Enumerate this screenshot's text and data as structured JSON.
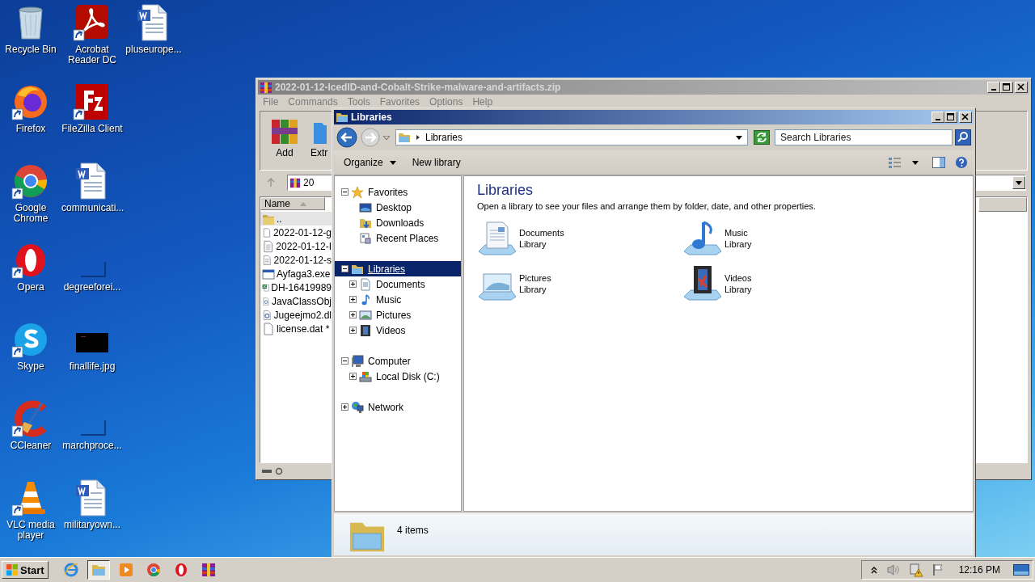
{
  "desktop_icons": [
    {
      "label": "Recycle Bin",
      "kind": "recycle",
      "shortcut": false
    },
    {
      "label": "Firefox",
      "kind": "firefox",
      "shortcut": true
    },
    {
      "label": "Google Chrome",
      "kind": "chrome",
      "shortcut": true
    },
    {
      "label": "Opera",
      "kind": "opera",
      "shortcut": true
    },
    {
      "label": "Skype",
      "kind": "skype",
      "shortcut": true
    },
    {
      "label": "CCleaner",
      "kind": "ccleaner",
      "shortcut": true
    },
    {
      "label": "VLC media player",
      "kind": "vlc",
      "shortcut": true
    },
    {
      "label": "Acrobat Reader DC",
      "kind": "acrobat",
      "shortcut": true
    },
    {
      "label": "FileZilla Client",
      "kind": "filezilla",
      "shortcut": true
    },
    {
      "label": "communicati...",
      "kind": "word",
      "shortcut": false
    },
    {
      "label": "degreeforei...",
      "kind": "blank",
      "shortcut": false
    },
    {
      "label": "finallife.jpg",
      "kind": "image",
      "shortcut": false
    },
    {
      "label": "marchproce...",
      "kind": "blank",
      "shortcut": false
    },
    {
      "label": "militaryown...",
      "kind": "word",
      "shortcut": false
    },
    {
      "label": "pluseurope...",
      "kind": "word",
      "shortcut": false
    }
  ],
  "winrar": {
    "title": "2022-01-12-IcedID-and-Cobalt-Strike-malware-and-artifacts.zip",
    "menu": [
      "File",
      "Commands",
      "Tools",
      "Favorites",
      "Options",
      "Help"
    ],
    "toolbar": [
      {
        "label": "Add",
        "kind": "add"
      },
      {
        "label": "Extr",
        "kind": "extract"
      }
    ],
    "path": "20",
    "column": "Name",
    "files": [
      {
        "name": "..",
        "kind": "folder",
        "selected": true
      },
      {
        "name": "2022-01-12-g",
        "kind": "file",
        "selected": false
      },
      {
        "name": "2022-01-12-I",
        "kind": "text",
        "selected": false
      },
      {
        "name": "2022-01-12-s",
        "kind": "text",
        "selected": false
      },
      {
        "name": "Ayfaga3.exe",
        "kind": "exe",
        "selected": false
      },
      {
        "name": "DH-16419989",
        "kind": "sheet",
        "selected": false
      },
      {
        "name": "JavaClassObj",
        "kind": "dll",
        "selected": false
      },
      {
        "name": "Jugeejmo2.dl",
        "kind": "dll",
        "selected": false
      },
      {
        "name": "license.dat *",
        "kind": "file",
        "selected": false
      }
    ]
  },
  "explorer": {
    "title": "Libraries",
    "address": "Libraries",
    "search": {
      "placeholder": "Search Libraries"
    },
    "toolbar": [
      "Organize",
      "New library"
    ],
    "nav": [
      {
        "label": "Favorites",
        "kind": "star",
        "expanded": true,
        "selected": false,
        "children": [
          {
            "label": "Desktop",
            "kind": "desktop",
            "selected": false
          },
          {
            "label": "Downloads",
            "kind": "downloads",
            "selected": false
          },
          {
            "label": "Recent Places",
            "kind": "recent",
            "selected": false
          }
        ]
      },
      {
        "label": "Libraries",
        "kind": "library",
        "expanded": true,
        "selected": true,
        "children": [
          {
            "label": "Documents",
            "kind": "documents",
            "expanded": false,
            "selected": false
          },
          {
            "label": "Music",
            "kind": "music",
            "expanded": false,
            "selected": false
          },
          {
            "label": "Pictures",
            "kind": "pictures",
            "expanded": false,
            "selected": false
          },
          {
            "label": "Videos",
            "kind": "videos",
            "expanded": false,
            "selected": false
          }
        ]
      },
      {
        "label": "Computer",
        "kind": "computer",
        "expanded": true,
        "selected": false,
        "children": [
          {
            "label": "Local Disk (C:)",
            "kind": "disk",
            "expanded": false,
            "selected": false
          }
        ]
      },
      {
        "label": "Network",
        "kind": "network",
        "expanded": false,
        "selected": false
      }
    ],
    "heading": "Libraries",
    "description": "Open a library to see your files and arrange them by folder, date, and other properties.",
    "libraries": [
      {
        "name": "Documents",
        "type": "Library",
        "kind": "documents"
      },
      {
        "name": "Music",
        "type": "Library",
        "kind": "music"
      },
      {
        "name": "Pictures",
        "type": "Library",
        "kind": "pictures"
      },
      {
        "name": "Videos",
        "type": "Library",
        "kind": "videos"
      }
    ],
    "status": "4 items"
  },
  "taskbar": {
    "start": "Start",
    "apps": [
      {
        "kind": "ie",
        "selected": false
      },
      {
        "kind": "explorer",
        "selected": true
      },
      {
        "kind": "media",
        "selected": false
      },
      {
        "kind": "chrome",
        "selected": false
      },
      {
        "kind": "opera",
        "selected": false
      },
      {
        "kind": "winrar",
        "selected": false
      }
    ],
    "clock": "12:16 PM"
  }
}
